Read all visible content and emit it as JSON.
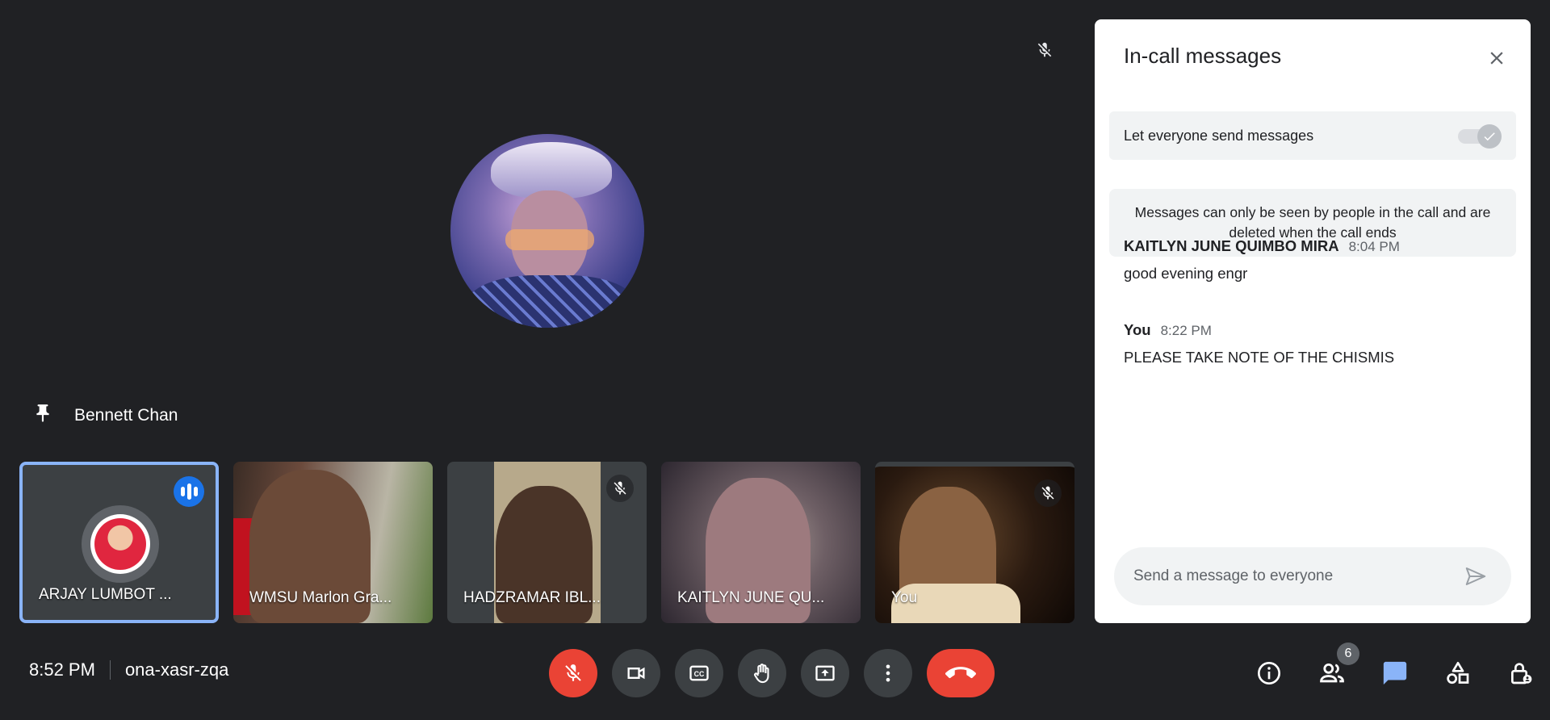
{
  "stage": {
    "pinned_name": "Bennett Chan"
  },
  "tiles": [
    {
      "name": "ARJAY LUMBOT ...",
      "state": "speaking"
    },
    {
      "name": "WMSU Marlon Gra...",
      "state": "video"
    },
    {
      "name": "HADZRAMAR IBL...",
      "state": "muted"
    },
    {
      "name": "KAITLYN JUNE QU...",
      "state": "video"
    },
    {
      "name": "You",
      "state": "muted"
    }
  ],
  "bottom_bar": {
    "time": "8:52 PM",
    "meeting_code": "ona-xasr-zqa",
    "participants_count": "6",
    "controls": [
      "mic-off-icon",
      "camera-icon",
      "captions-icon",
      "raise-hand-icon",
      "present-screen-icon",
      "more-options-icon",
      "end-call-icon"
    ],
    "right_controls": [
      "info-icon",
      "people-icon",
      "chat-icon",
      "activities-icon",
      "host-controls-icon"
    ]
  },
  "chat_panel": {
    "title": "In-call messages",
    "setting_label": "Let everyone send messages",
    "setting_enabled": true,
    "notice": "Messages can only be seen by people in the call and are deleted when the call ends",
    "messages": [
      {
        "sender": "KAITLYN JUNE QUIMBO MIRA",
        "time": "8:04 PM",
        "text": "good evening engr"
      },
      {
        "sender": "You",
        "time": "8:22 PM",
        "text": "PLEASE TAKE NOTE OF THE CHISMIS"
      }
    ],
    "composer_placeholder": "Send a message to everyone"
  },
  "colors": {
    "background": "#202124",
    "accent_blue": "#8ab4f8",
    "end_call_red": "#ea4335",
    "active_speaker": "#1a73e8"
  }
}
